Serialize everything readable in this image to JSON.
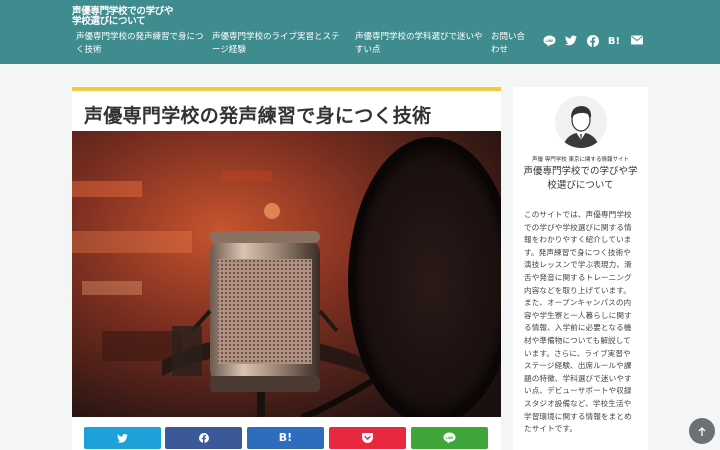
{
  "header": {
    "site_title": "声優専門学校での学びや学校選びについて",
    "nav": [
      {
        "label": "声優専門学校の発声練習で身につく技術"
      },
      {
        "label": "声優専門学校のライブ実習とステージ経験"
      },
      {
        "label": "声優専門学校の学科選びで迷いやすい点"
      },
      {
        "label": "お問い合わせ"
      }
    ],
    "social_icons": [
      "line-icon",
      "twitter-icon",
      "facebook-icon",
      "hatena-bookmark-icon",
      "mail-icon"
    ],
    "hatena_label": "B!"
  },
  "article": {
    "title": "声優専門学校の発声練習で身につく技術",
    "image_alt": "studio-microphone-with-pop-filter",
    "share_buttons": [
      {
        "icon": "twitter-icon",
        "color": "#1da1d9"
      },
      {
        "icon": "facebook-icon",
        "color": "#3b5998"
      },
      {
        "icon": "hatena-bookmark-icon",
        "label": "B!",
        "color": "#2c6ebd"
      },
      {
        "icon": "pocket-icon",
        "color": "#e8283f"
      },
      {
        "icon": "line-icon",
        "color": "#3fa63a"
      }
    ]
  },
  "sidebar": {
    "kicker": "声優 専門学校 東京に関する情報サイト",
    "site_name": "声優専門学校での学びや学校選びについて",
    "description": "このサイトでは、声優専門学校での学びや学校選びに関する情報をわかりやすく紹介しています。発声練習で身につく技術や演技レッスンで学ぶ表現力、滑舌や発音に関するトレーニング内容などを取り上げています。また、オープンキャンパスの内容や学生寮と一人暮らしに関する情報、入学前に必要となる機材や準備物についても解説しています。さらに、ライブ実習やステージ経験、出席ルールや課題の特徴、学科選びで迷いやすい点、デビューサポートや収録スタジオ設備など、学校生活や学習環境に関する情報をまとめたサイトです。"
  },
  "colors": {
    "header_bg": "#3f8c8f",
    "title_accent": "#f5c842",
    "page_bg": "#f4f5f5"
  }
}
